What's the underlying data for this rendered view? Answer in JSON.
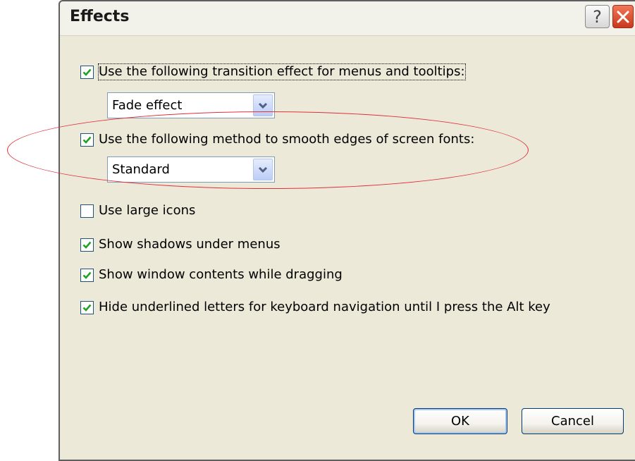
{
  "dialog": {
    "title": "Effects",
    "help_glyph": "?",
    "close_icon": "close-icon"
  },
  "options": {
    "transition": {
      "checked": true,
      "label": "Use the following transition effect for menus and tooltips:",
      "select_value": "Fade effect"
    },
    "smoothing": {
      "checked": true,
      "label": "Use the following method to smooth edges of screen fonts:",
      "select_value": "Standard"
    },
    "large_icons": {
      "checked": false,
      "label": "Use large icons"
    },
    "menu_shadows": {
      "checked": true,
      "label": "Show shadows under menus"
    },
    "window_drag": {
      "checked": true,
      "label": "Show window contents while dragging"
    },
    "hide_underlines": {
      "checked": true,
      "label": "Hide underlined letters for keyboard navigation until I press the Alt key"
    }
  },
  "buttons": {
    "ok": "OK",
    "cancel": "Cancel"
  },
  "colors": {
    "accent": "#1c5180",
    "check": "#21a121",
    "annotation": "#e0303a",
    "close": "#c9381b"
  }
}
